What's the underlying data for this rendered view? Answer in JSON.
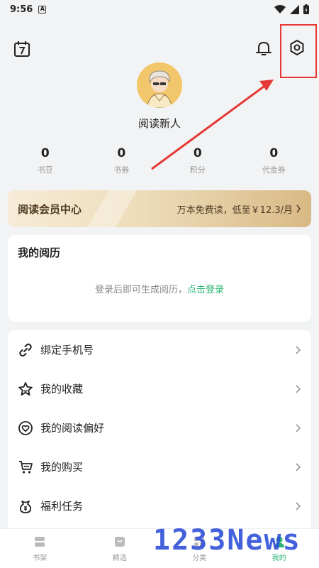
{
  "status_bar": {
    "time": "9:56",
    "notification_glyph": "A"
  },
  "profile": {
    "username": "阅读新人"
  },
  "stats": [
    {
      "value": "0",
      "label": "书豆"
    },
    {
      "value": "0",
      "label": "书券"
    },
    {
      "value": "0",
      "label": "积分"
    },
    {
      "value": "0",
      "label": "代金券"
    }
  ],
  "vip": {
    "title": "阅读会员中心",
    "promo": "万本免费读，低至￥12.3/月"
  },
  "history": {
    "title": "我的阅历",
    "hint": "登录后即可生成阅历，",
    "login_link": "点击登录"
  },
  "menu": [
    {
      "label": "绑定手机号",
      "icon": "link-icon"
    },
    {
      "label": "我的收藏",
      "icon": "star-icon"
    },
    {
      "label": "我的阅读偏好",
      "icon": "heart-icon"
    },
    {
      "label": "我的购买",
      "icon": "cart-icon"
    },
    {
      "label": "福利任务",
      "icon": "gift-icon"
    }
  ],
  "tabs": [
    {
      "label": "书架",
      "icon": "bookshelf-icon",
      "active": false
    },
    {
      "label": "精选",
      "icon": "featured-icon",
      "active": false
    },
    {
      "label": "分类",
      "icon": "category-icon",
      "active": false
    },
    {
      "label": "我的",
      "icon": "profile-icon",
      "active": true
    }
  ],
  "watermark": "1233News",
  "colors": {
    "accent": "#2bb673",
    "vip_text": "#4e3a22",
    "annotation": "#e53935",
    "watermark": "#2f50d8"
  }
}
